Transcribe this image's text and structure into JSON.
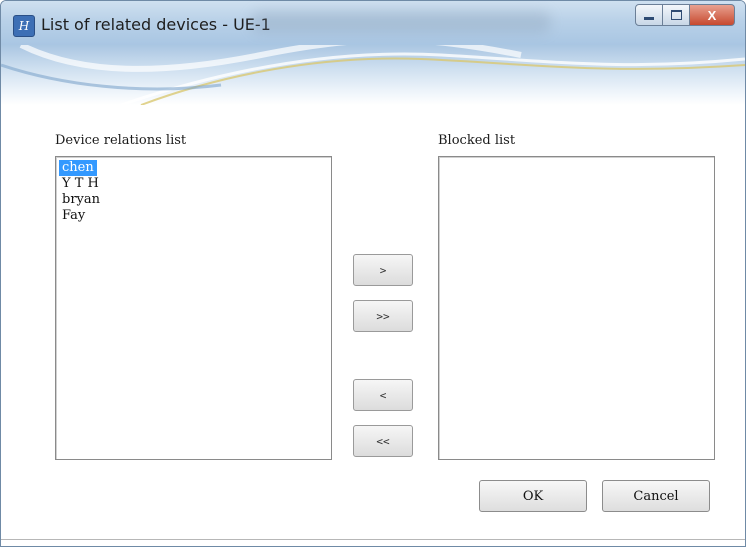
{
  "window": {
    "title": "List of related devices - UE-1",
    "app_icon_glyph": "H",
    "close_glyph": "X"
  },
  "left_panel": {
    "label": "Device relations list",
    "items": [
      {
        "label": "chen",
        "selected": true
      },
      {
        "label": "Y T H",
        "selected": false
      },
      {
        "label": "bryan",
        "selected": false
      },
      {
        "label": "Fay",
        "selected": false
      }
    ]
  },
  "right_panel": {
    "label": "Blocked list",
    "items": []
  },
  "move_buttons": {
    "move_right": ">",
    "move_all_right": ">>",
    "move_left": "<",
    "move_all_left": "<<"
  },
  "dialog_buttons": {
    "ok": "OK",
    "cancel": "Cancel"
  },
  "colors": {
    "selection": "#3399ff",
    "titlebar": "#b9d1e8",
    "close_button": "#c7492f"
  },
  "icons": [
    "app-icon",
    "minimize-icon",
    "maximize-icon",
    "close-icon"
  ]
}
